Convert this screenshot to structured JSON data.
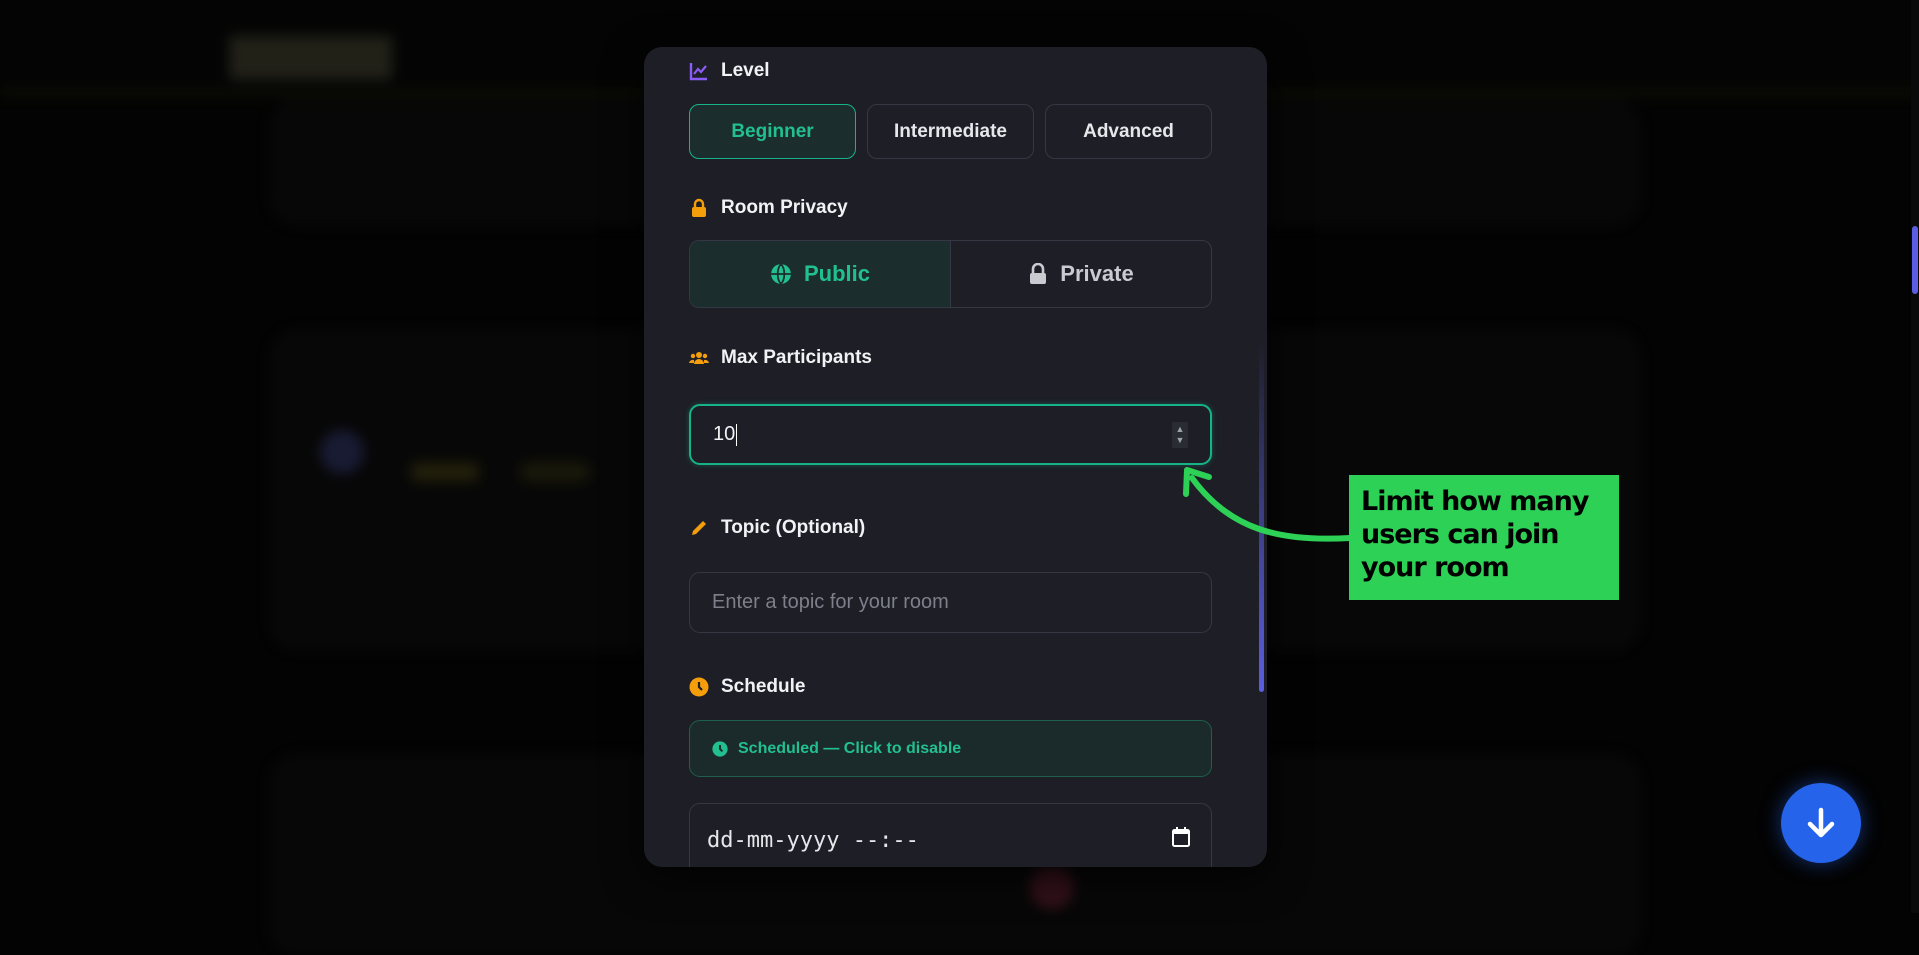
{
  "modal": {
    "level": {
      "label": "Level",
      "options": [
        "Beginner",
        "Intermediate",
        "Advanced"
      ],
      "selected": "Beginner"
    },
    "privacy": {
      "label": "Room Privacy",
      "public": "Public",
      "private": "Private",
      "selected": "Public"
    },
    "max_participants": {
      "label": "Max Participants",
      "value": "10"
    },
    "topic": {
      "label": "Topic (Optional)",
      "placeholder": "Enter a topic for your room"
    },
    "schedule": {
      "label": "Schedule",
      "status": "Scheduled — Click to disable",
      "datetime_placeholder": "dd-mm-yyyy --:--"
    }
  },
  "callout": {
    "text": "Limit how many users can join your room"
  },
  "colors": {
    "accent": "#22c08f",
    "callout": "#2dd155",
    "fab": "#2563eb"
  }
}
